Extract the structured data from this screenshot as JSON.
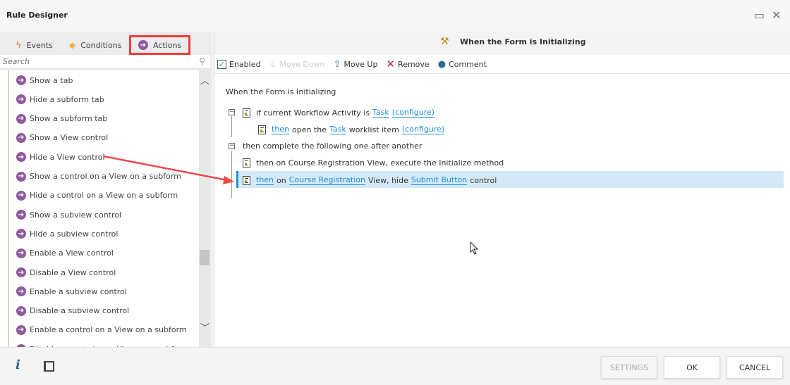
{
  "window": {
    "title": "Rule Designer",
    "maximize_icon": "maximize-icon",
    "close_icon": "close-icon"
  },
  "tabs": [
    {
      "label": "Events"
    },
    {
      "label": "Conditions"
    },
    {
      "label": "Actions"
    }
  ],
  "search": {
    "placeholder": "Search"
  },
  "actions": [
    "Show a tab",
    "Hide a subform tab",
    "Show a subform tab",
    "Show a View control",
    "Hide a View control",
    "Show a control on a View on a subform",
    "Hide a control on a View on a subform",
    "Show a subview control",
    "Hide a subview control",
    "Enable a View control",
    "Disable a View control",
    "Enable a subview control",
    "Disable a subview control",
    "Enable a control on a View on a subform",
    "Disable a control on a View on a subform"
  ],
  "rule": {
    "header": "When the Form is Initializing"
  },
  "toolbar": {
    "enabled": "Enabled",
    "move_down": "Move Down",
    "move_up": "Move Up",
    "remove": "Remove",
    "comment": "Comment"
  },
  "tree": {
    "root": "When the Form is Initializing",
    "cond": {
      "text": "if current Workflow Activity is",
      "link1": "Task",
      "link2": "(configure)"
    },
    "cond_action": {
      "then": "then",
      "t1": "open the",
      "link1": "Task",
      "t2": "worklist item",
      "link2": "(configure)"
    },
    "group": "then complete the following one after another",
    "a1": "then on Course Registration View, execute the Initialize method",
    "a2": {
      "then": "then",
      "t1": "on",
      "link1": "Course Registration",
      "t2": "View, hide",
      "link2": "Submit Button",
      "t3": "control"
    }
  },
  "footer": {
    "settings": "SETTINGS",
    "ok": "OK",
    "cancel": "CANCEL"
  },
  "colors": {
    "accent": "#1e8fd8",
    "highlight": "#f03c3c",
    "action_icon": "#8e5a9e"
  }
}
